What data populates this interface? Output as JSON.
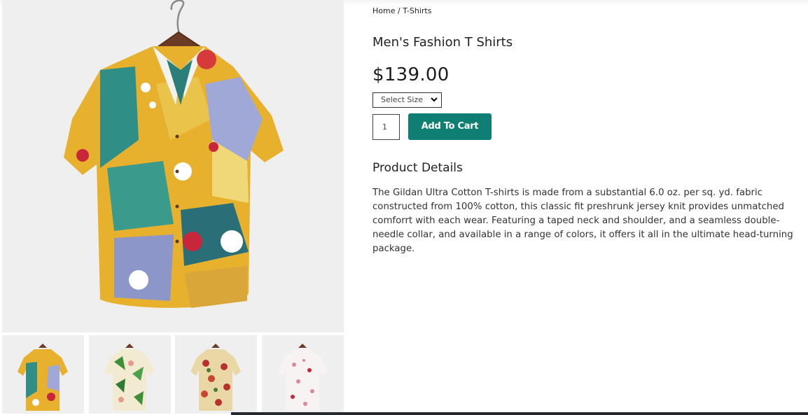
{
  "breadcrumb": {
    "home": "Home",
    "separator": " / ",
    "current": "T-Shirts"
  },
  "product": {
    "title": "Men's Fashion T Shirts",
    "price": "$139.00",
    "size_select": {
      "selected": "Select Size"
    },
    "quantity": "1",
    "add_to_cart_label": "Add To Cart",
    "details_heading": "Product Details",
    "details_text": "The Gildan Ultra Cotton T-shirts is made from a substantial 6.0 oz. per sq. yd. fabric constructed from 100% cotton, this classic fit preshrunk jersey knit provides unmatched comforrt with each wear. Featuring a taped neck and shoulder, and a seamless double-needle collar, and available in a range of colors, it offers it all in the ultimate head-turning package."
  },
  "colors": {
    "accent": "#0f7f74",
    "image_bg": "#efefef",
    "footer_bar": "#23292e"
  },
  "images": {
    "main": "patterned-shirt-mustard-teal",
    "thumbnails": [
      "shirt-mustard-teal",
      "shirt-tropical-leaf",
      "shirt-red-floral",
      "shirt-white-pink-floral"
    ]
  }
}
